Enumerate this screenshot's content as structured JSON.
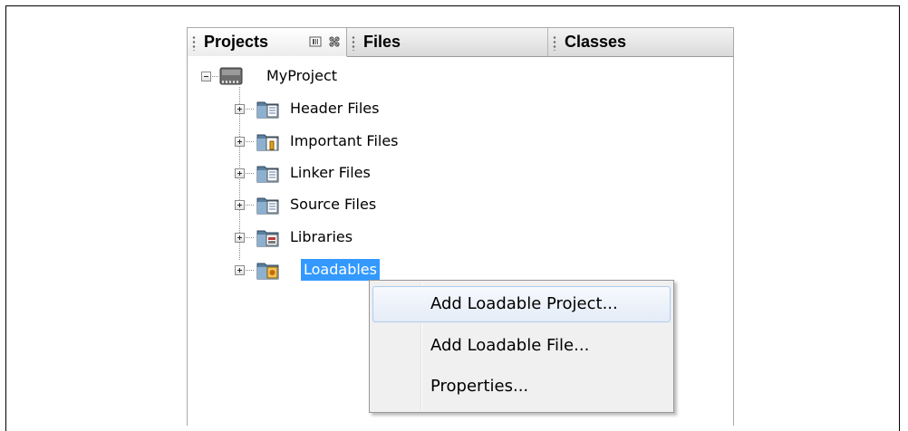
{
  "tabs": [
    {
      "label": "Projects",
      "active": true
    },
    {
      "label": "Files",
      "active": false
    },
    {
      "label": "Classes",
      "active": false
    }
  ],
  "tree": {
    "root": {
      "label": "MyProject",
      "icon": "chip-icon",
      "expanded": true
    },
    "children": [
      {
        "label": "Header Files",
        "icon": "folder-document-icon"
      },
      {
        "label": "Important Files",
        "icon": "folder-important-icon"
      },
      {
        "label": "Linker Files",
        "icon": "folder-document-icon"
      },
      {
        "label": "Source Files",
        "icon": "folder-document-icon"
      },
      {
        "label": "Libraries",
        "icon": "folder-library-icon"
      },
      {
        "label": "Loadables",
        "icon": "folder-loadable-icon",
        "selected": true
      }
    ]
  },
  "context_menu": {
    "items": [
      {
        "label": "Add Loadable Project...",
        "hovered": true
      },
      {
        "label": "Add Loadable File..."
      },
      {
        "label": "Properties..."
      }
    ]
  },
  "colors": {
    "selection": "#3399ff",
    "menu_hover_border": "#aeccef",
    "panel_border": "#a9a9a9"
  }
}
